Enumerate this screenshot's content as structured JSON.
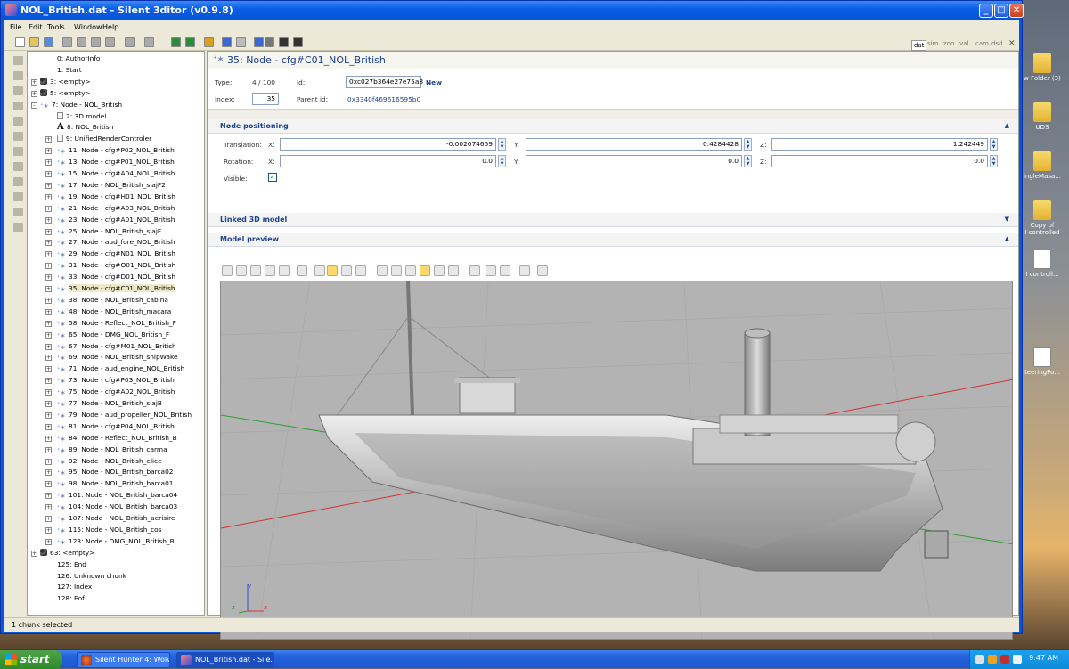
{
  "window": {
    "title": "NOL_British.dat - Silent 3ditor (v0.9.8)"
  },
  "menu": [
    "File",
    "Edit",
    "Tools",
    "Window",
    "Help"
  ],
  "right_tabs": [
    "dat",
    "sim",
    "zon",
    "val",
    "cam",
    "dsd"
  ],
  "tree": [
    {
      "label": "0: AuthorInfo",
      "indent": 0,
      "icon": "none",
      "exp": ""
    },
    {
      "label": "1: Start",
      "indent": 0,
      "icon": "none",
      "exp": ""
    },
    {
      "label": "3: <empty>",
      "indent": 0,
      "icon": "chunk",
      "exp": "+"
    },
    {
      "label": "5: <empty>",
      "indent": 0,
      "icon": "chunk",
      "exp": "+"
    },
    {
      "label": "7: Node - NOL_British",
      "indent": 0,
      "icon": "node",
      "exp": "-"
    },
    {
      "label": "2: 3D model",
      "indent": 1,
      "icon": "doc",
      "exp": ""
    },
    {
      "label": "8: NOL_British",
      "indent": 1,
      "icon": "letter",
      "exp": ""
    },
    {
      "label": "9: UnifiedRenderControler",
      "indent": 1,
      "icon": "doc",
      "exp": "+"
    },
    {
      "label": "11: Node - cfg#P02_NOL_British",
      "indent": 1,
      "icon": "node",
      "exp": "+"
    },
    {
      "label": "13: Node - cfg#P01_NOL_British",
      "indent": 1,
      "icon": "node",
      "exp": "+"
    },
    {
      "label": "15: Node - cfg#A04_NOL_British",
      "indent": 1,
      "icon": "node",
      "exp": "+"
    },
    {
      "label": "17: Node - NOL_British_siajF2",
      "indent": 1,
      "icon": "node",
      "exp": "+"
    },
    {
      "label": "19: Node - cfg#H01_NOL_British",
      "indent": 1,
      "icon": "node",
      "exp": "+"
    },
    {
      "label": "21: Node - cfg#A03_NOL_British",
      "indent": 1,
      "icon": "node",
      "exp": "+"
    },
    {
      "label": "23: Node - cfg#A01_NOL_British",
      "indent": 1,
      "icon": "node",
      "exp": "+"
    },
    {
      "label": "25: Node - NOL_British_siajF",
      "indent": 1,
      "icon": "node",
      "exp": "+"
    },
    {
      "label": "27: Node - aud_fore_NOL_British",
      "indent": 1,
      "icon": "node",
      "exp": "+"
    },
    {
      "label": "29: Node - cfg#N01_NOL_British",
      "indent": 1,
      "icon": "node",
      "exp": "+"
    },
    {
      "label": "31: Node - cfg#O01_NOL_British",
      "indent": 1,
      "icon": "node",
      "exp": "+"
    },
    {
      "label": "33: Node - cfg#D01_NOL_British",
      "indent": 1,
      "icon": "node",
      "exp": "+"
    },
    {
      "label": "35: Node - cfg#C01_NOL_British",
      "indent": 1,
      "icon": "node",
      "exp": "+",
      "selected": true
    },
    {
      "label": "38: Node - NOL_British_cabina",
      "indent": 1,
      "icon": "node",
      "exp": "+"
    },
    {
      "label": "48: Node - NOL_British_macara",
      "indent": 1,
      "icon": "node",
      "exp": "+"
    },
    {
      "label": "58: Node - Reflect_NOL_British_F",
      "indent": 1,
      "icon": "node",
      "exp": "+"
    },
    {
      "label": "65: Node - DMG_NOL_British_F",
      "indent": 1,
      "icon": "node",
      "exp": "+"
    },
    {
      "label": "67: Node - cfg#M01_NOL_British",
      "indent": 1,
      "icon": "node",
      "exp": "+"
    },
    {
      "label": "69: Node - NOL_British_shipWake",
      "indent": 1,
      "icon": "node",
      "exp": "+"
    },
    {
      "label": "71: Node - aud_engine_NOL_British",
      "indent": 1,
      "icon": "node",
      "exp": "+"
    },
    {
      "label": "73: Node - cfg#P03_NOL_British",
      "indent": 1,
      "icon": "node",
      "exp": "+"
    },
    {
      "label": "75: Node - cfg#A02_NOL_British",
      "indent": 1,
      "icon": "node",
      "exp": "+"
    },
    {
      "label": "77: Node - NOL_British_siajB",
      "indent": 1,
      "icon": "node",
      "exp": "+"
    },
    {
      "label": "79: Node - aud_propeller_NOL_British",
      "indent": 1,
      "icon": "node",
      "exp": "+"
    },
    {
      "label": "81: Node - cfg#P04_NOL_British",
      "indent": 1,
      "icon": "node",
      "exp": "+"
    },
    {
      "label": "84: Node - Reflect_NOL_British_B",
      "indent": 1,
      "icon": "node",
      "exp": "+"
    },
    {
      "label": "89: Node - NOL_British_carma",
      "indent": 1,
      "icon": "node",
      "exp": "+"
    },
    {
      "label": "92: Node - NOL_British_elice",
      "indent": 1,
      "icon": "node",
      "exp": "+"
    },
    {
      "label": "95: Node - NOL_British_barca02",
      "indent": 1,
      "icon": "node",
      "exp": "+"
    },
    {
      "label": "98: Node - NOL_British_barca01",
      "indent": 1,
      "icon": "node",
      "exp": "+"
    },
    {
      "label": "101: Node - NOL_British_barca04",
      "indent": 1,
      "icon": "node",
      "exp": "+"
    },
    {
      "label": "104: Node - NOL_British_barca03",
      "indent": 1,
      "icon": "node",
      "exp": "+"
    },
    {
      "label": "107: Node - NOL_British_aerisire",
      "indent": 1,
      "icon": "node",
      "exp": "+"
    },
    {
      "label": "115: Node - NOL_British_cos",
      "indent": 1,
      "icon": "node",
      "exp": "+"
    },
    {
      "label": "123: Node - DMG_NOL_British_B",
      "indent": 1,
      "icon": "node",
      "exp": "+"
    },
    {
      "label": "63: <empty>",
      "indent": 0,
      "icon": "chunk",
      "exp": "+"
    },
    {
      "label": "125: End",
      "indent": 0,
      "icon": "none",
      "exp": ""
    },
    {
      "label": "126: Unknown chunk",
      "indent": 0,
      "icon": "none",
      "exp": ""
    },
    {
      "label": "127: Index",
      "indent": 0,
      "icon": "none",
      "exp": ""
    },
    {
      "label": "128: Eof",
      "indent": 0,
      "icon": "none",
      "exp": ""
    }
  ],
  "header": {
    "title": "35: Node - cfg#C01_NOL_British"
  },
  "props": {
    "type_label": "Type:",
    "type_value": "4 / 100",
    "id_label": "Id:",
    "id_value": "0xc027b364e27e75a8",
    "id_new": "New",
    "index_label": "Index:",
    "index_value": "35",
    "parent_label": "Parent id:",
    "parent_value": "0x3340f469616595b0"
  },
  "sections": {
    "positioning": "Node positioning",
    "linked": "Linked 3D model",
    "preview": "Model preview"
  },
  "positioning": {
    "translation_label": "Translation:",
    "rotation_label": "Rotation:",
    "visible_label": "Visible:",
    "x": "X:",
    "y": "Y:",
    "z": "Z:",
    "tx": "-0.002074659",
    "ty": "0.4284428",
    "tz": "1.242449",
    "rx": "0.0",
    "ry": "0.0",
    "rz": "0.0",
    "visible": true
  },
  "viewport": {
    "axis_x": "x",
    "axis_y": "y",
    "axis_z": "z"
  },
  "status": "1 chunk selected",
  "taskbar": {
    "start": "start",
    "tasks": [
      "Silent Hunter 4: Wolv...",
      "NOL_British.dat - Sile..."
    ],
    "clock": "9:47 AM"
  },
  "desktop": [
    {
      "label": "w Folder (3)",
      "icon": "folder"
    },
    {
      "label": "UDS",
      "icon": "folder"
    },
    {
      "label": "ingleMasa...",
      "icon": "folder"
    },
    {
      "label": "Copy of\nI controlled",
      "icon": "folder"
    },
    {
      "label": "I controll...",
      "icon": "doc"
    },
    {
      "label": "teeringPo...",
      "icon": "doc"
    }
  ],
  "colors": {
    "title_blue": "#0a5ee6",
    "section_blue": "#1e4590",
    "viewport_bg": "#b3b3b3",
    "axis_red": "#d43030",
    "axis_green": "#2e9e2e",
    "axis_blue": "#3c4fd6"
  }
}
